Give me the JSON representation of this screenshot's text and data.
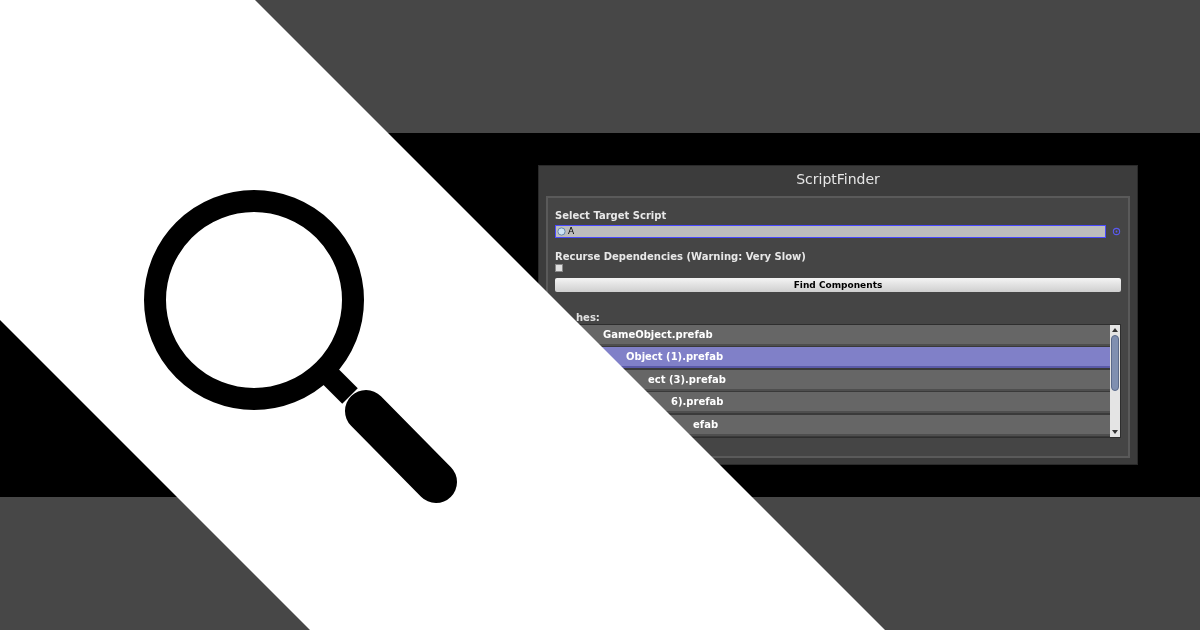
{
  "window": {
    "title": "ScriptFinder"
  },
  "target_field": {
    "label": "Select Target Script",
    "value": "A"
  },
  "recurse": {
    "label": "Recurse Dependencies (Warning: Very Slow)",
    "checked": false
  },
  "find_button": {
    "label": "Find Components"
  },
  "matches": {
    "label": "hes:",
    "rows": [
      {
        "text": "GameObject.prefab",
        "selected": false
      },
      {
        "text": "Object (1).prefab",
        "selected": true
      },
      {
        "text": "ect (3).prefab",
        "selected": false
      },
      {
        "text": "6).prefab",
        "selected": false
      },
      {
        "text": "efab",
        "selected": false
      }
    ]
  }
}
